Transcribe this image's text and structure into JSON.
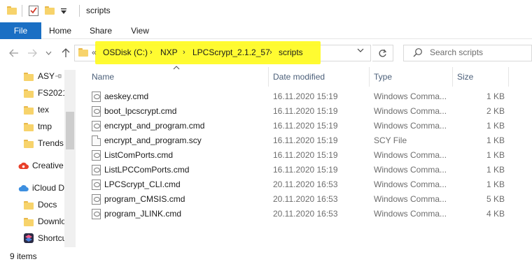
{
  "window": {
    "title": "scripts"
  },
  "ribbon": {
    "tabs": [
      "File",
      "Home",
      "Share",
      "View"
    ]
  },
  "address": {
    "overflow": "«",
    "crumbs": [
      "OSDisk (C:)",
      "NXP",
      "LPCScrypt_2.1.2_57",
      "scripts"
    ],
    "highlight_color": "#fffb1f"
  },
  "search": {
    "placeholder": "Search scripts"
  },
  "navpane": {
    "items": [
      {
        "label": "ASY",
        "icon": "folder-icon"
      },
      {
        "label": "FS2021",
        "icon": "folder-icon"
      },
      {
        "label": "tex",
        "icon": "folder-icon"
      },
      {
        "label": "tmp",
        "icon": "folder-icon"
      },
      {
        "label": "Trends",
        "icon": "folder-icon"
      },
      {
        "label": "Creative",
        "icon": "creative-cloud-icon"
      },
      {
        "label": "iCloud D",
        "icon": "icloud-icon"
      },
      {
        "label": "Docs",
        "icon": "folder-icon"
      },
      {
        "label": "Downlo",
        "icon": "folder-icon"
      },
      {
        "label": "Shortcu",
        "icon": "shortcuts-icon"
      }
    ]
  },
  "columns": {
    "name": "Name",
    "date": "Date modified",
    "type": "Type",
    "size": "Size"
  },
  "files": [
    {
      "name": "aeskey.cmd",
      "date": "16.11.2020 15:19",
      "type": "Windows Comma...",
      "size": "1 KB",
      "icon": "cmd-file-icon"
    },
    {
      "name": "boot_lpcscrypt.cmd",
      "date": "16.11.2020 15:19",
      "type": "Windows Comma...",
      "size": "2 KB",
      "icon": "cmd-file-icon"
    },
    {
      "name": "encrypt_and_program.cmd",
      "date": "16.11.2020 15:19",
      "type": "Windows Comma...",
      "size": "1 KB",
      "icon": "cmd-file-icon"
    },
    {
      "name": "encrypt_and_program.scy",
      "date": "16.11.2020 15:19",
      "type": "SCY File",
      "size": "1 KB",
      "icon": "generic-file-icon"
    },
    {
      "name": "ListComPorts.cmd",
      "date": "16.11.2020 15:19",
      "type": "Windows Comma...",
      "size": "1 KB",
      "icon": "cmd-file-icon"
    },
    {
      "name": "ListLPCComPorts.cmd",
      "date": "16.11.2020 15:19",
      "type": "Windows Comma...",
      "size": "1 KB",
      "icon": "cmd-file-icon"
    },
    {
      "name": "LPCScrypt_CLI.cmd",
      "date": "20.11.2020 16:53",
      "type": "Windows Comma...",
      "size": "1 KB",
      "icon": "cmd-file-icon"
    },
    {
      "name": "program_CMSIS.cmd",
      "date": "20.11.2020 16:53",
      "type": "Windows Comma...",
      "size": "5 KB",
      "icon": "cmd-file-icon"
    },
    {
      "name": "program_JLINK.cmd",
      "date": "20.11.2020 16:53",
      "type": "Windows Comma...",
      "size": "4 KB",
      "icon": "cmd-file-icon"
    }
  ],
  "status": {
    "count": "9 items"
  }
}
